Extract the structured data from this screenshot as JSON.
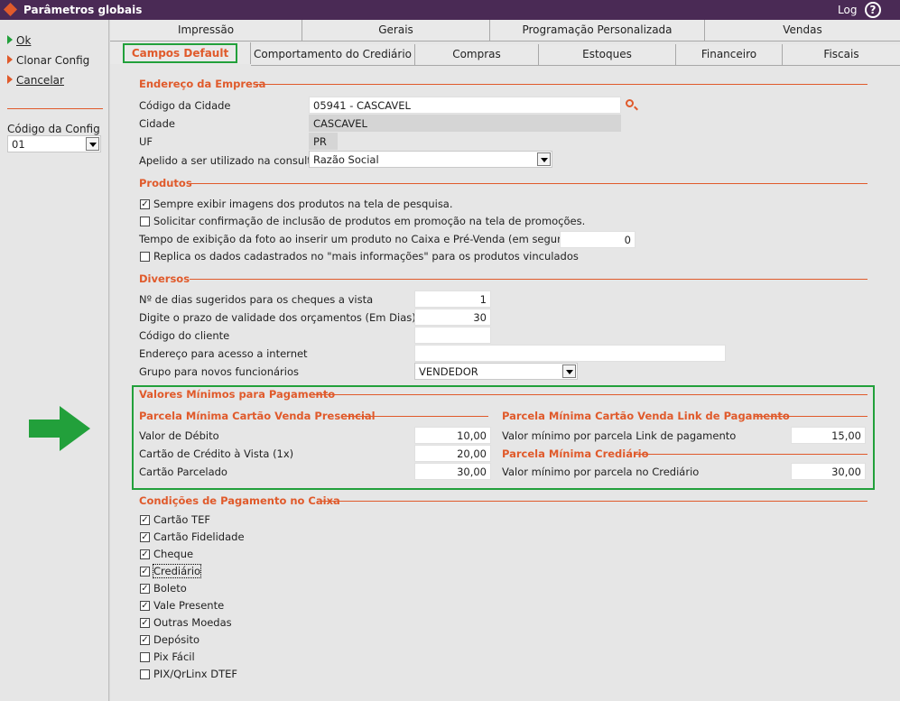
{
  "window": {
    "title": "Parâmetros globais",
    "log": "Log",
    "help_icon": "help-circle-icon"
  },
  "left": {
    "actions": [
      {
        "label": "Ok",
        "accel": "O",
        "icon": "green-arrow-icon"
      },
      {
        "label": "Clonar Config",
        "icon": "orange-arrow-icon"
      },
      {
        "label": "Cancelar",
        "icon": "orange-arrow-icon"
      }
    ],
    "config_label": "Código da Config",
    "config_value": "01"
  },
  "tabs_row1": [
    "Impressão",
    "Gerais",
    "Programação Personalizada",
    "Vendas"
  ],
  "tabs_row2": [
    "Campos Default",
    "Comportamento do Crediário",
    "Compras",
    "Estoques",
    "Financeiro",
    "Fiscais"
  ],
  "empresa": {
    "title": "Endereço da Empresa",
    "codigo_cidade_label": "Código da Cidade",
    "codigo_cidade_value": "05941 - CASCAVEL",
    "cidade_label": "Cidade",
    "cidade_value": "CASCAVEL",
    "uf_label": "UF",
    "uf_value": "PR",
    "apelido_label": "Apelido a ser utilizado na consulta",
    "apelido_value": "Razão Social"
  },
  "produtos": {
    "title": "Produtos",
    "opt1": "Sempre exibir imagens dos produtos na tela de pesquisa.",
    "opt1_checked": true,
    "opt2": "Solicitar confirmação de inclusão de produtos em promoção na tela de promoções.",
    "opt2_checked": false,
    "tempo_label": "Tempo de exibição da foto ao inserir um produto no Caixa e Pré-Venda (em segundos):",
    "tempo_value": "0",
    "opt3": "Replica os dados cadastrados no \"mais informações\" para os produtos vinculados",
    "opt3_checked": false
  },
  "diversos": {
    "title": "Diversos",
    "dias_label": "Nº de dias sugeridos para os cheques a vista",
    "dias_value": "1",
    "prazo_label": "Digite o prazo de validade dos orçamentos (Em Dias)",
    "prazo_value": "30",
    "cliente_label": "Código do cliente",
    "cliente_value": "",
    "endereco_label": "Endereço para acesso a internet",
    "endereco_value": "",
    "grupo_label": "Grupo para novos funcionários",
    "grupo_value": "VENDEDOR"
  },
  "valores": {
    "title": "Valores Mínimos para Pagamento",
    "presencial_title": "Parcela Mínima Cartão Venda Presencial",
    "debito_label": "Valor de Débito",
    "debito_value": "10,00",
    "credito_label": "Cartão de Crédito à Vista (1x)",
    "credito_value": "20,00",
    "parcelado_label": "Cartão Parcelado",
    "parcelado_value": "30,00",
    "link_title": "Parcela Mínima Cartão Venda Link de Pagamento",
    "link_label": "Valor mínimo por parcela Link de pagamento",
    "link_value": "15,00",
    "crediario_title": "Parcela Mínima Crediário",
    "crediario_label": "Valor mínimo por parcela no Crediário",
    "crediario_value": "30,00"
  },
  "condicoes": {
    "title": "Condições de Pagamento no Caixa",
    "items": [
      {
        "label": "Cartão TEF",
        "checked": true
      },
      {
        "label": "Cartão Fidelidade",
        "checked": true
      },
      {
        "label": "Cheque",
        "checked": true
      },
      {
        "label": "Crediário",
        "checked": true
      },
      {
        "label": "Boleto",
        "checked": true
      },
      {
        "label": "Vale Presente",
        "checked": true
      },
      {
        "label": "Outras Moedas",
        "checked": true
      },
      {
        "label": "Depósito",
        "checked": true
      },
      {
        "label": "Pix Fácil",
        "checked": false
      },
      {
        "label": "PIX/QrLinx DTEF",
        "checked": false
      }
    ]
  },
  "colors": {
    "accent": "#e05a2b",
    "highlight": "#22a03b",
    "titlebar": "#4a2a55"
  }
}
